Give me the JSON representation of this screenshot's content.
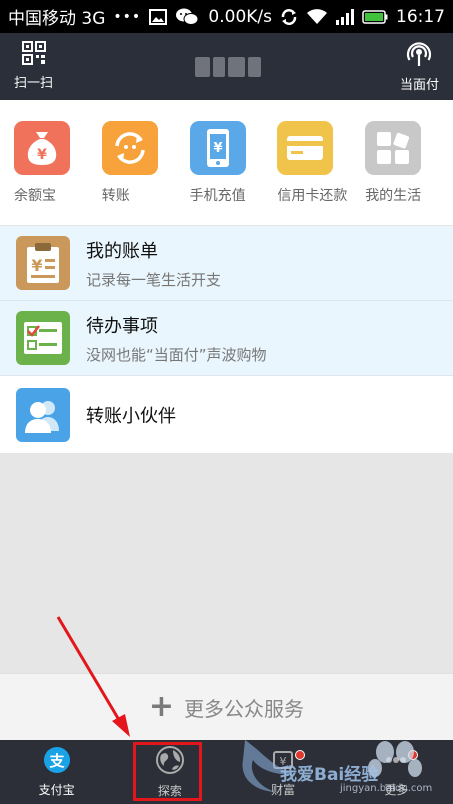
{
  "status_bar": {
    "carrier": "中国移动 3G",
    "dots": "•••",
    "speed": "0.00K/s",
    "time": "16:17",
    "icons": [
      "image-icon",
      "wechat-icon",
      "sync-icon",
      "wifi-icon",
      "signal-icon",
      "battery-icon"
    ]
  },
  "header": {
    "scan_label": "扫一扫",
    "pay_label": "当面付"
  },
  "apps": [
    {
      "label": "余额宝",
      "icon": "money-bag-icon",
      "color": "#f0725a"
    },
    {
      "label": "转账",
      "icon": "transfer-icon",
      "color": "#f7a23a"
    },
    {
      "label": "手机充值",
      "icon": "phone-recharge-icon",
      "color": "#5aa8e8"
    },
    {
      "label": "信用卡还款",
      "icon": "credit-card-icon",
      "color": "#f0c34a"
    },
    {
      "label": "我的生活",
      "icon": "my-life-icon",
      "color": "#c8c8c8"
    }
  ],
  "list": [
    {
      "title": "我的账单",
      "subtitle": "记录每一笔生活开支",
      "icon": "bill-icon",
      "bg": "#e9f6fd"
    },
    {
      "title": "待办事项",
      "subtitle": "没网也能“当面付”声波购物",
      "icon": "todo-icon",
      "bg": "#e9f6fd"
    },
    {
      "title": "转账小伙伴",
      "subtitle": "",
      "icon": "contacts-icon",
      "bg": "#ffffff"
    }
  ],
  "more_services": "更多公众服务",
  "nav": [
    {
      "label": "支付宝",
      "icon": "alipay-icon",
      "badge": false
    },
    {
      "label": "探索",
      "icon": "explore-icon",
      "badge": false
    },
    {
      "label": "财富",
      "icon": "wealth-icon",
      "badge": true
    },
    {
      "label": "更多",
      "icon": "more-icon",
      "badge": true
    }
  ],
  "watermark": {
    "text": "我爱Bai经验",
    "url": "jingyan.baidu.com"
  }
}
